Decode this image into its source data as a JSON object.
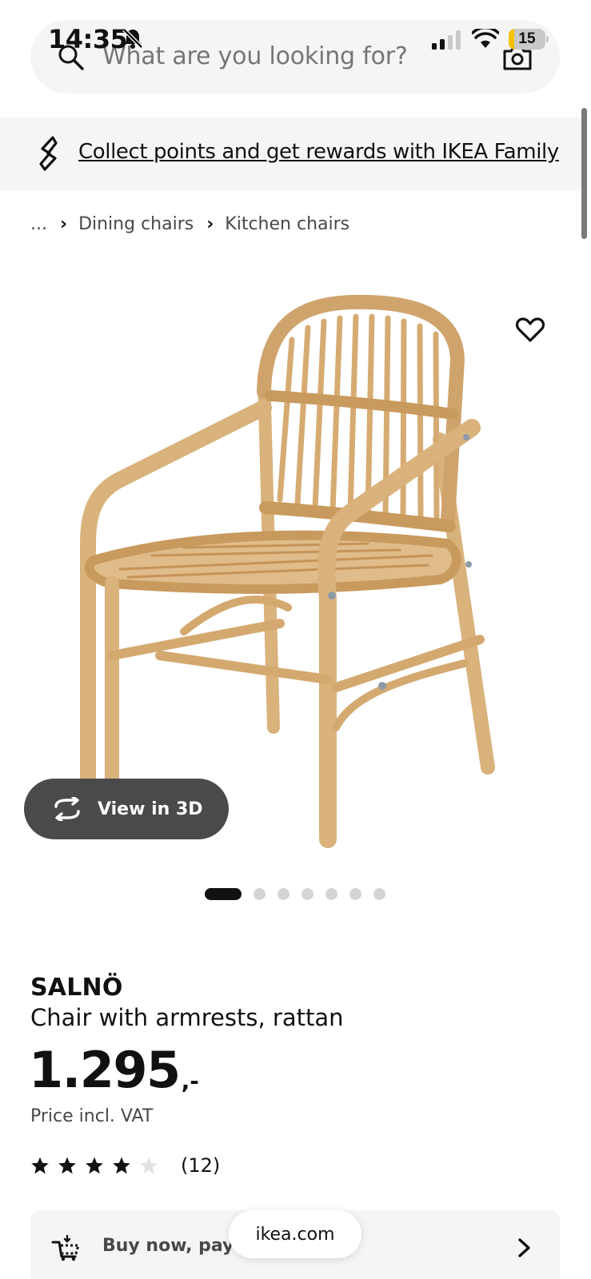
{
  "status_bar": {
    "time": "14:35",
    "battery_level": "15",
    "battery_fraction": 0.15
  },
  "search": {
    "placeholder": "What are you looking for?"
  },
  "family_banner": {
    "text": "Collect points and get rewards with IKEA Family"
  },
  "breadcrumb": {
    "items": [
      "...",
      "Dining chairs",
      "Kitchen chairs"
    ]
  },
  "gallery": {
    "view3d_label": "View in 3D",
    "dot_count": 7,
    "active_index": 0
  },
  "product": {
    "name": "SALNÖ",
    "description": "Chair with armrests, rattan",
    "price": "1.295",
    "price_suffix": ",-",
    "price_note": "Price incl. VAT",
    "rating_value": 4,
    "rating_max": 5,
    "review_count": "(12)"
  },
  "bnpl": {
    "label": "Buy now, pay l"
  },
  "browser": {
    "url_label": "ikea.com"
  },
  "colors": {
    "accent": "#111111",
    "muted": "#767676",
    "surface": "#f5f5f5",
    "rattan": "#d9b27c",
    "battery_low": "#f2c200"
  },
  "icons": [
    "search-icon",
    "camera-icon",
    "bell-off-icon",
    "signal-icon",
    "wifi-icon",
    "battery-icon",
    "ikea-family-icon",
    "heart-icon",
    "rotate-3d-icon",
    "star-icon",
    "cart-payment-icon",
    "chevron-right-icon"
  ]
}
